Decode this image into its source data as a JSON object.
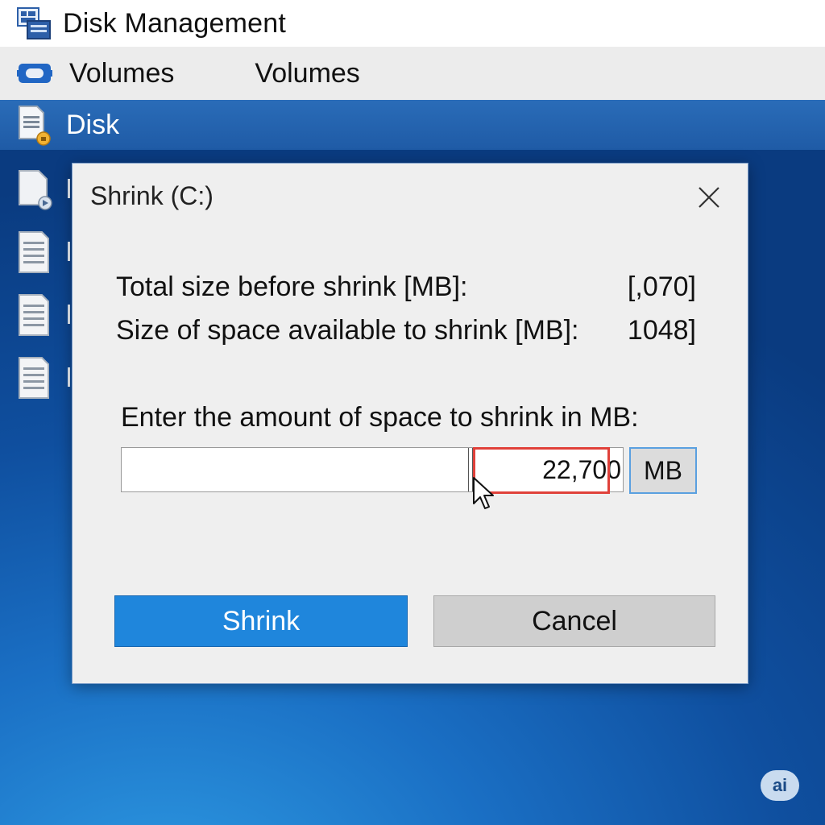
{
  "window": {
    "title": "Disk Management"
  },
  "menu": {
    "item1": "Volumes",
    "item2": "Volumes"
  },
  "tree": {
    "selected_label": "Disk"
  },
  "dialog": {
    "title": "Shrink (C:)",
    "rows": [
      {
        "label": "Total size before shrink [MB]:",
        "value": "[,070]"
      },
      {
        "label": "Size of space available to shrink [MB]:",
        "value": "1048]"
      }
    ],
    "prompt": "Enter the amount of space to shrink in MB:",
    "input_value": "22,700",
    "unit": "MB",
    "shrink_button": "Shrink",
    "cancel_button": "Cancel"
  },
  "badge": "ai",
  "colors": {
    "accent": "#1f86dc",
    "highlight": "#e0413a",
    "selection": "#2a6cb8"
  }
}
